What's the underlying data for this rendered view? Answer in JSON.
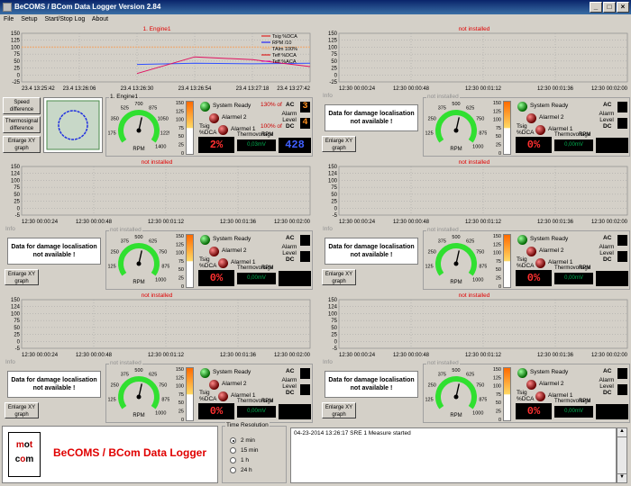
{
  "title": "BeCOMS / BCom Data Logger  Version 2.84",
  "menu": [
    "File",
    "Setup",
    "Start/Stop Log",
    "About"
  ],
  "panels": [
    {
      "chart_title": "1. Engine1",
      "yticks": [
        "150",
        "125",
        "100",
        "75",
        "50",
        "25",
        "0",
        "-25"
      ],
      "xticks": [
        "23.4 13:25:42",
        "23.4 13:26:06",
        "23.4 13:26:30",
        "23.4 13:26:54",
        "23.4 13:27:18",
        "23.4 13:27:42"
      ],
      "legend": [
        "Tsig %DCA",
        "RPM /10",
        "TAlm 100%",
        "Teff %DCA",
        "Teff %ACA"
      ],
      "legend_colors": [
        "#e00000",
        "#0000ff",
        "#e8b080",
        "#e00000",
        "#e000a0"
      ],
      "info_title": "Info",
      "buttons": [
        "Speed difference",
        "Thermosignal difference",
        "Enlarge XY graph"
      ],
      "gauge_title": "1. Engine1",
      "gauge_ticks": [
        "175",
        "350",
        "525",
        "700",
        "875",
        "1050",
        "1225",
        "1400"
      ],
      "rpm": "RPM",
      "scale": [
        "150",
        "125",
        "100",
        "75",
        "50",
        "25",
        "0"
      ],
      "leds": {
        "ready": "System Ready",
        "alarm2": "Alarmel 2",
        "alarm1": "Alarmel 1",
        "tsig": "Tsig %DCA"
      },
      "ac_pct": "130% of",
      "dc_pct": "100% of",
      "ac": "AC",
      "dc": "DC",
      "alarm_level": "Alarm Level",
      "ac_level": "3",
      "dc_level": "4",
      "tsig_value": "2%",
      "thermo_label": "Thermovoltage",
      "thermo_value": "0,03mV",
      "rpm_value": "428",
      "rpm_label": "RPM"
    },
    {
      "chart_title": "not installed",
      "yticks": [
        "150",
        "125",
        "100",
        "75",
        "50",
        "25",
        "0",
        "-25"
      ],
      "xticks": [
        "12:30 00:00:24",
        "12:30 00:00:48",
        "12:30 00:01:12",
        "12:30 00:01:36",
        "12:30 00:02:00"
      ],
      "info_title": "Info",
      "dmsg": "Data for damage localisation not available !",
      "xy": "Enlarge XY graph",
      "gauge_title": "not installed",
      "gauge_ticks": [
        "125",
        "250",
        "375",
        "500",
        "625",
        "750",
        "875",
        "1000"
      ],
      "rpm": "RPM",
      "scale": [
        "150",
        "125",
        "100",
        "75",
        "50",
        "25",
        "0"
      ],
      "leds": {
        "ready": "System Ready",
        "alarm2": "Alarmel 2",
        "alarm1": "Alarmel 1",
        "tsig": "Tsig %DCA"
      },
      "ac": "AC",
      "dc": "DC",
      "alarm_level": "Alarm Level",
      "tsig_value": "0%",
      "thermo_label": "Thermovoltage",
      "thermo_value": "0,00mV",
      "rpm_label": "RPM"
    },
    {
      "chart_title": "not installed",
      "yticks": [
        "150",
        "124",
        "100",
        "75",
        "50",
        "25",
        "0",
        "-5"
      ],
      "xticks": [
        "12:30 00:00:24",
        "12:30 00:00:48",
        "12:30 00:01:12",
        "12:30 00:01:36",
        "12:30 00:02:00"
      ],
      "info_title": "Info",
      "dmsg": "Data for damage localisation not available !",
      "xy": "Enlarge XY graph",
      "gauge_title": "not installed",
      "gauge_ticks": [
        "125",
        "250",
        "375",
        "500",
        "625",
        "750",
        "875",
        "1000"
      ],
      "rpm": "RPM",
      "scale": [
        "150",
        "125",
        "100",
        "75",
        "50",
        "25",
        "0"
      ],
      "leds": {
        "ready": "System Ready",
        "alarm2": "Alarmel 2",
        "alarm1": "Alarmel 1",
        "tsig": "Tsig %DCA"
      },
      "ac": "AC",
      "dc": "DC",
      "alarm_level": "Alarm Level",
      "tsig_value": "0%",
      "thermo_label": "Thermovoltage",
      "thermo_value": "0,00mV",
      "rpm_label": "RPM"
    },
    {
      "chart_title": "not installed",
      "yticks": [
        "150",
        "124",
        "100",
        "75",
        "50",
        "25",
        "0",
        "-5"
      ],
      "xticks": [
        "12:30 00:00:24",
        "12:30 00:00:48",
        "12:30 00:01:12",
        "12:30 00:01:36",
        "12:30 00:02:00"
      ],
      "info_title": "Info",
      "dmsg": "Data for damage localisation not available !",
      "xy": "Enlarge XY graph",
      "gauge_title": "not installed",
      "gauge_ticks": [
        "125",
        "250",
        "375",
        "500",
        "625",
        "750",
        "875",
        "1000"
      ],
      "rpm": "RPM",
      "scale": [
        "150",
        "125",
        "100",
        "75",
        "50",
        "25",
        "0"
      ],
      "leds": {
        "ready": "System Ready",
        "alarm2": "Alarmel 2",
        "alarm1": "Alarmel 1",
        "tsig": "Tsig %DCA"
      },
      "ac": "AC",
      "dc": "DC",
      "alarm_level": "Alarm Level",
      "tsig_value": "0%",
      "thermo_label": "Thermovoltage",
      "thermo_value": "0,00mV",
      "rpm_label": "RPM"
    },
    {
      "chart_title": "not installed",
      "yticks": [
        "150",
        "124",
        "100",
        "75",
        "50",
        "25",
        "0",
        "-5"
      ],
      "xticks": [
        "12:30 00:00:24",
        "12:30 00:00:48",
        "12:30 00:01:12",
        "12:30 00:01:36",
        "12:30 00:02:00"
      ],
      "info_title": "Info",
      "dmsg": "Data for damage localisation not available !",
      "xy": "Enlarge XY graph",
      "gauge_title": "not installed",
      "gauge_ticks": [
        "125",
        "250",
        "375",
        "500",
        "625",
        "750",
        "875",
        "1000"
      ],
      "rpm": "RPM",
      "scale": [
        "150",
        "125",
        "100",
        "75",
        "50",
        "25",
        "0"
      ],
      "leds": {
        "ready": "System Ready",
        "alarm2": "Alarmel 2",
        "alarm1": "Alarmel 1",
        "tsig": "Tsig %DCA"
      },
      "ac": "AC",
      "dc": "DC",
      "alarm_level": "Alarm Level",
      "tsig_value": "0%",
      "thermo_label": "Thermovoltage",
      "thermo_value": "0,00mV",
      "rpm_label": "RPM"
    },
    {
      "chart_title": "not installed",
      "yticks": [
        "150",
        "124",
        "100",
        "75",
        "50",
        "25",
        "0",
        "-5"
      ],
      "xticks": [
        "12:30 00:00:24",
        "12:30 00:00:48",
        "12:30 00:01:12",
        "12:30 00:01:36",
        "12:30 00:02:00"
      ],
      "info_title": "Info",
      "dmsg": "Data for damage localisation not available !",
      "xy": "Enlarge XY graph",
      "gauge_title": "not installed",
      "gauge_ticks": [
        "125",
        "250",
        "375",
        "500",
        "625",
        "750",
        "875",
        "1000"
      ],
      "rpm": "RPM",
      "scale": [
        "150",
        "125",
        "100",
        "75",
        "50",
        "25",
        "0"
      ],
      "leds": {
        "ready": "System Ready",
        "alarm2": "Alarmel 2",
        "alarm1": "Alarmel 1",
        "tsig": "Tsig %DCA"
      },
      "ac": "AC",
      "dc": "DC",
      "alarm_level": "Alarm Level",
      "tsig_value": "0%",
      "thermo_label": "Thermovoltage",
      "thermo_value": "0,00mV",
      "rpm_label": "RPM"
    }
  ],
  "footer": {
    "logo": "m o t c o m",
    "app_name": "BeCOMS / BCom Data  Logger",
    "time_res_title": "Time Resolution",
    "time_res_options": [
      "2 min",
      "15 min",
      "1 h",
      "24 h"
    ],
    "time_res_selected": "2 min",
    "log_message": "04-23-2014 13:26:17 SRE 1 Measure started"
  },
  "chart_data": [
    {
      "type": "line",
      "title": "1. Engine1",
      "x": [
        "23.4 13:25:42",
        "23.4 13:26:06",
        "23.4 13:26:30",
        "23.4 13:26:54",
        "23.4 13:27:18",
        "23.4 13:27:42"
      ],
      "ylim": [
        -25,
        150
      ],
      "series": [
        {
          "name": "RPM /10",
          "values": [
            null,
            null,
            38,
            42,
            40,
            42
          ]
        },
        {
          "name": "Teff %DCA",
          "values": [
            null,
            null,
            5,
            65,
            55,
            30
          ]
        },
        {
          "name": "TAlm 100%",
          "values": [
            100,
            100,
            100,
            100,
            100,
            100
          ]
        }
      ]
    }
  ]
}
